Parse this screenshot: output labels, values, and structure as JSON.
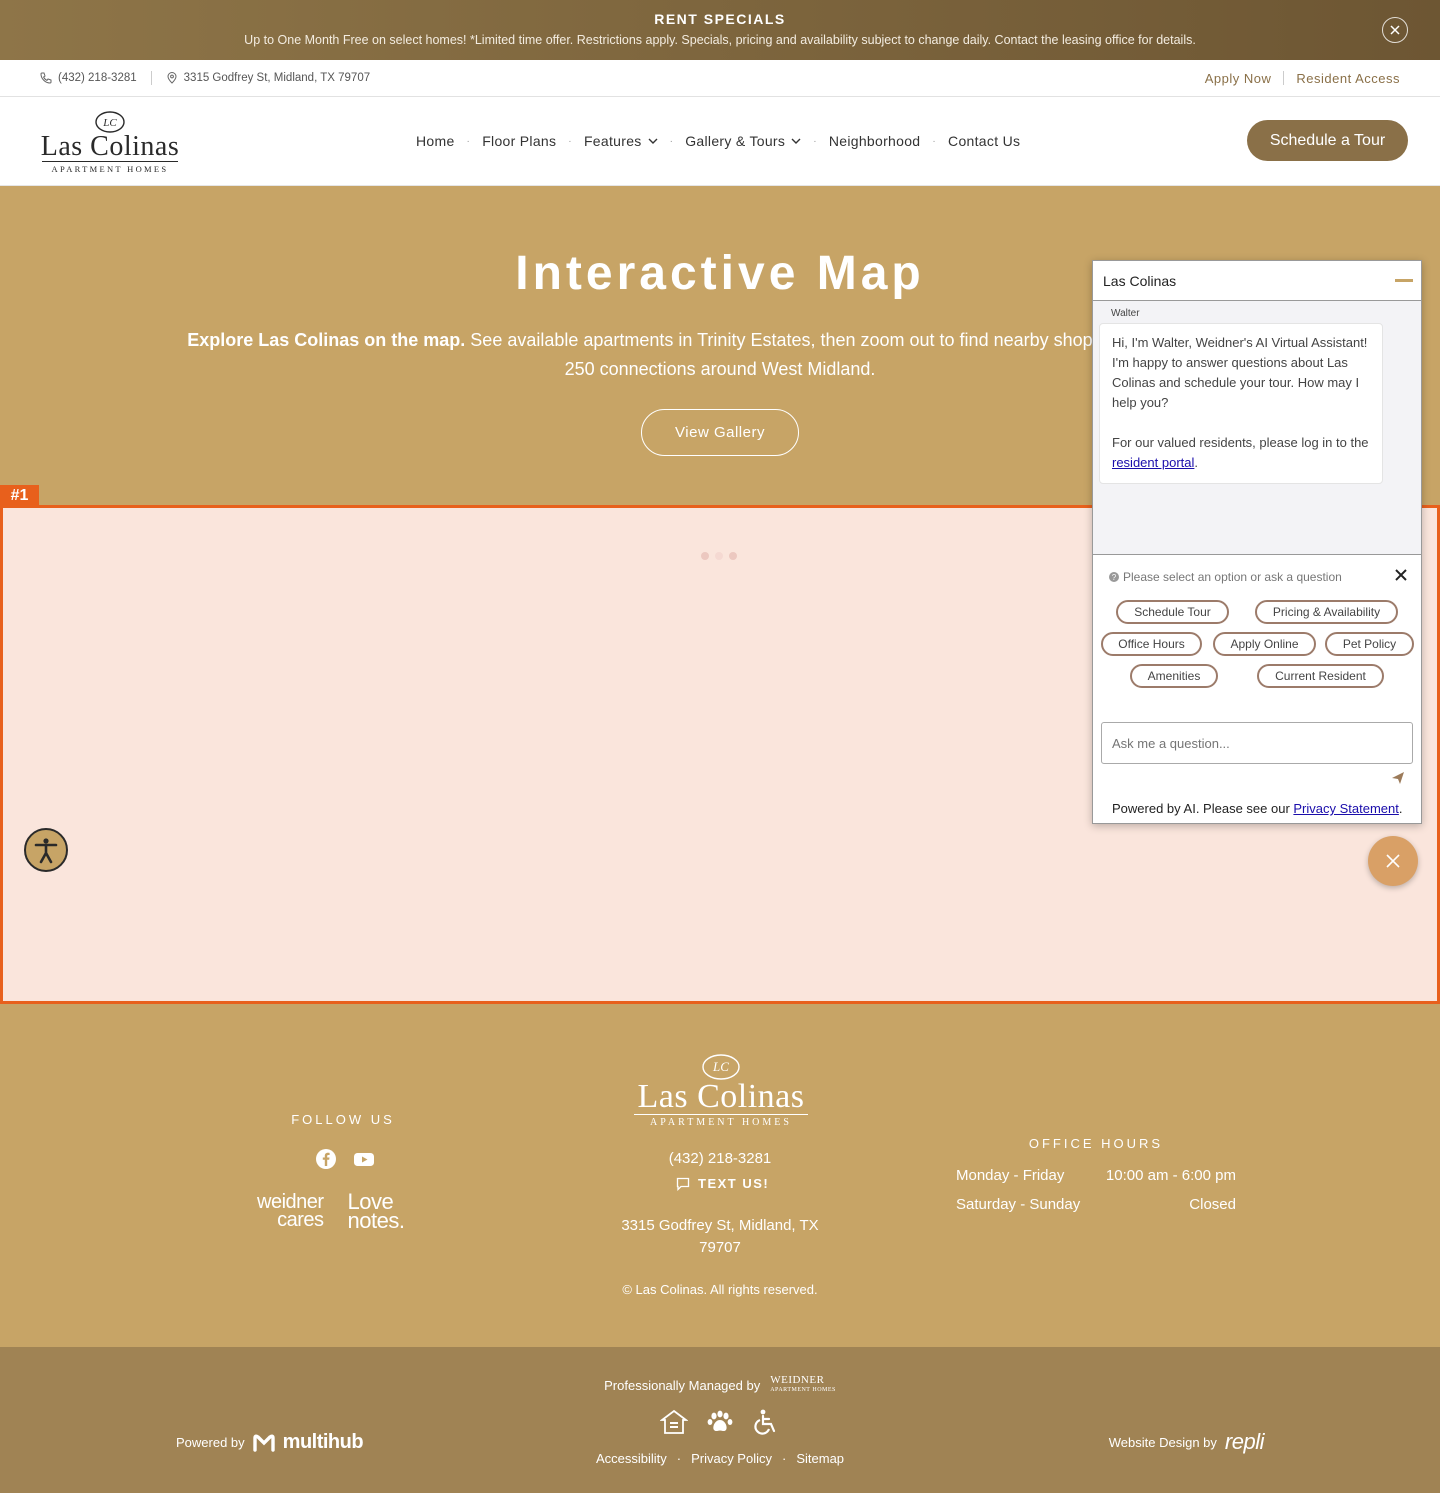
{
  "banner": {
    "title": "RENT SPECIALS",
    "text": "Up to One Month Free on select homes! *Limited time offer. Restrictions apply. Specials, pricing and availability subject to change daily. Contact the leasing office for details."
  },
  "utility": {
    "phone": "(432) 218-3281",
    "address": "3315 Godfrey St, Midland, TX 79707",
    "apply": "Apply Now",
    "resident": "Resident Access"
  },
  "header": {
    "logo_name": "Las Colinas",
    "logo_sub": "APARTMENT HOMES",
    "nav": [
      "Home",
      "Floor Plans",
      "Features",
      "Gallery & Tours",
      "Neighborhood",
      "Contact Us"
    ],
    "cta": "Schedule a Tour"
  },
  "hero": {
    "title": "Interactive Map",
    "desc_bold": "Explore Las Colinas on the map.",
    "desc_rest": " See available apartments in Trinity Estates, then zoom out to find nearby shopping, quick Highway 250 connections around West Midland.",
    "button": "View Gallery"
  },
  "map": {
    "label": "#1"
  },
  "chat": {
    "title": "Las Colinas",
    "sender": "Walter",
    "message": "Hi, I'm Walter, Weidner's AI Virtual Assistant! I'm happy to answer questions about Las Colinas and schedule your tour. How may I help you?",
    "resident_prefix": "For our valued residents, please log in to the ",
    "resident_link": "resident portal",
    "resident_suffix": ".",
    "hint": "Please select an option or ask a question",
    "options": [
      "Schedule Tour",
      "Pricing & Availability",
      "Office Hours",
      "Apply Online",
      "Pet Policy",
      "Amenities",
      "Current Resident"
    ],
    "input_placeholder": "Ask me a question...",
    "powered_prefix": "Powered by AI. Please see our ",
    "powered_link": "Privacy Statement",
    "powered_suffix": "."
  },
  "footer": {
    "follow": "FOLLOW US",
    "brand1a": "weidner",
    "brand1b": "cares",
    "brand2a": "Love",
    "brand2b": "notes.",
    "phone": "(432) 218-3281",
    "text_us": "TEXT US!",
    "address": "3315 Godfrey St, Midland, TX 79707",
    "copyright": "© Las Colinas. All rights reserved.",
    "hours_title": "OFFICE HOURS",
    "hours": [
      {
        "days": "Monday - Friday",
        "time": "10:00 am - 6:00 pm"
      },
      {
        "days": "Saturday - Sunday",
        "time": "Closed"
      }
    ]
  },
  "bottom": {
    "managed": "Professionally Managed by",
    "weidner": "WEIDNER",
    "weidner_sub": "APARTMENT HOMES",
    "links": [
      "Accessibility",
      "Privacy Policy",
      "Sitemap"
    ],
    "powered": "Powered by",
    "multihub": "multihub",
    "webdesign": "Website Design by",
    "repli": "repli"
  },
  "colors": {
    "brand": "#8a7048",
    "gold": "#c7a466",
    "map_highlight": "#e8601c"
  }
}
